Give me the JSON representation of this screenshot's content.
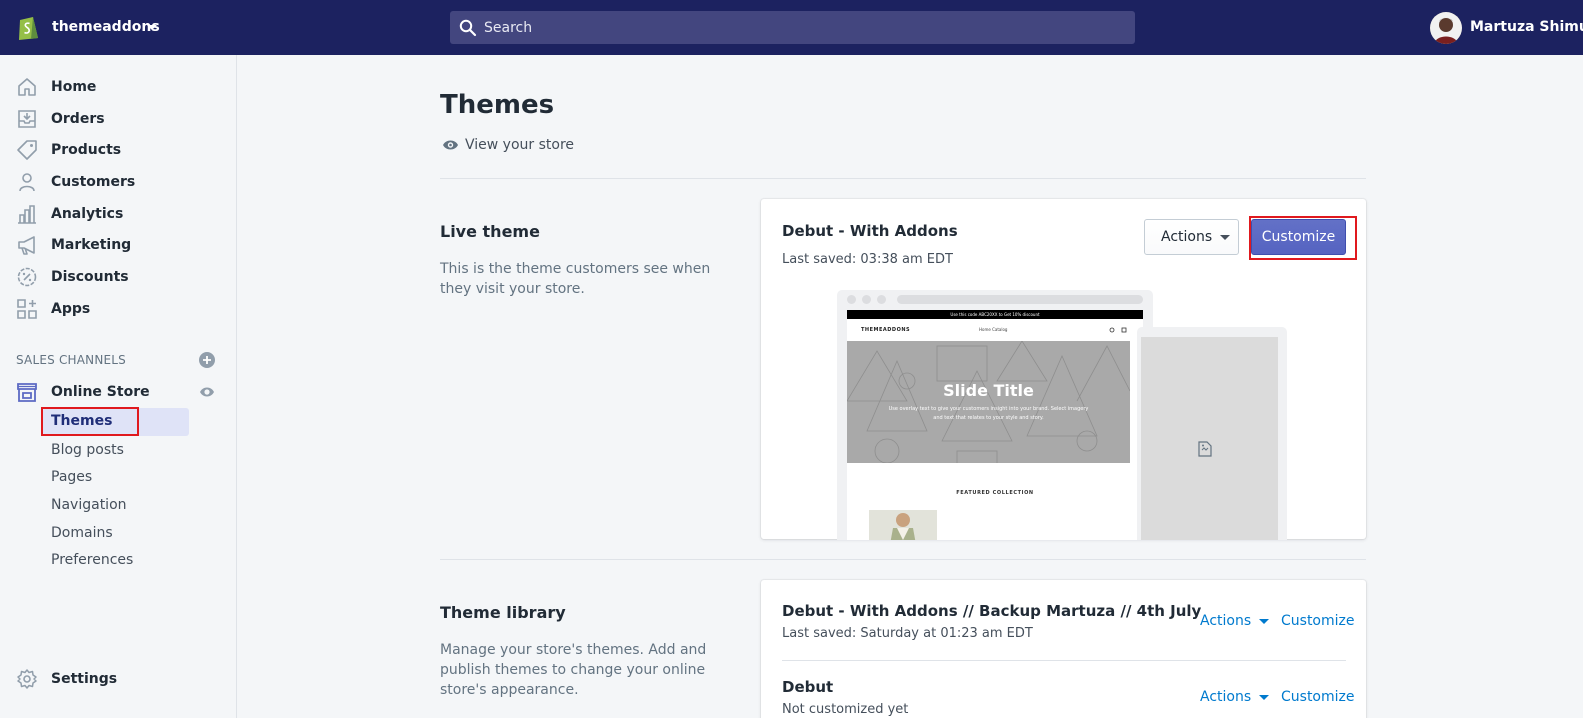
{
  "topbar": {
    "store_name": "themeaddons",
    "search_placeholder": "Search",
    "user_name": "Martuza Shimul"
  },
  "sidebar": {
    "items": [
      {
        "label": "Home",
        "icon": "home-icon"
      },
      {
        "label": "Orders",
        "icon": "orders-icon"
      },
      {
        "label": "Products",
        "icon": "tag-icon"
      },
      {
        "label": "Customers",
        "icon": "person-icon"
      },
      {
        "label": "Analytics",
        "icon": "bar-chart-icon"
      },
      {
        "label": "Marketing",
        "icon": "megaphone-icon"
      },
      {
        "label": "Discounts",
        "icon": "discount-icon"
      },
      {
        "label": "Apps",
        "icon": "apps-icon"
      }
    ],
    "sales_channels_label": "SALES CHANNELS",
    "online_store": {
      "label": "Online Store",
      "sub_items": [
        "Themes",
        "Blog posts",
        "Pages",
        "Navigation",
        "Domains",
        "Preferences"
      ],
      "active": "Themes"
    },
    "settings_label": "Settings"
  },
  "main": {
    "title": "Themes",
    "view_store": "View your store",
    "live_theme": {
      "heading": "Live theme",
      "description": "This is the theme customers see when they visit your store.",
      "theme_name": "Debut - With Addons",
      "last_saved": "Last saved: 03:38 am EDT",
      "actions_label": "Actions",
      "customize_label": "Customize",
      "preview": {
        "announcement": "Use this code ABC20XX to Get 10% discount",
        "logo": "THEMEADDONS",
        "nav": "Home    Catalog",
        "slide_title": "Slide Title",
        "slide_text": "Use overlay text to give your customers insight into your brand. Select imagery and text that relates to your style and story.",
        "featured": "FEATURED COLLECTION"
      }
    },
    "library": {
      "heading": "Theme library",
      "description": "Manage your store's themes. Add and publish themes to change your online store's appearance.",
      "themes": [
        {
          "name": "Debut - With Addons // Backup Martuza // 4th July",
          "meta": "Last saved: Saturday at 01:23 am EDT",
          "actions": "Actions",
          "customize": "Customize"
        },
        {
          "name": "Debut",
          "meta": "Not customized yet",
          "actions": "Actions",
          "customize": "Customize"
        }
      ]
    }
  },
  "colors": {
    "topbar": "#1c2260",
    "accent": "#5c6ac4",
    "link": "#007ace",
    "highlight_box": "#e0191e"
  }
}
